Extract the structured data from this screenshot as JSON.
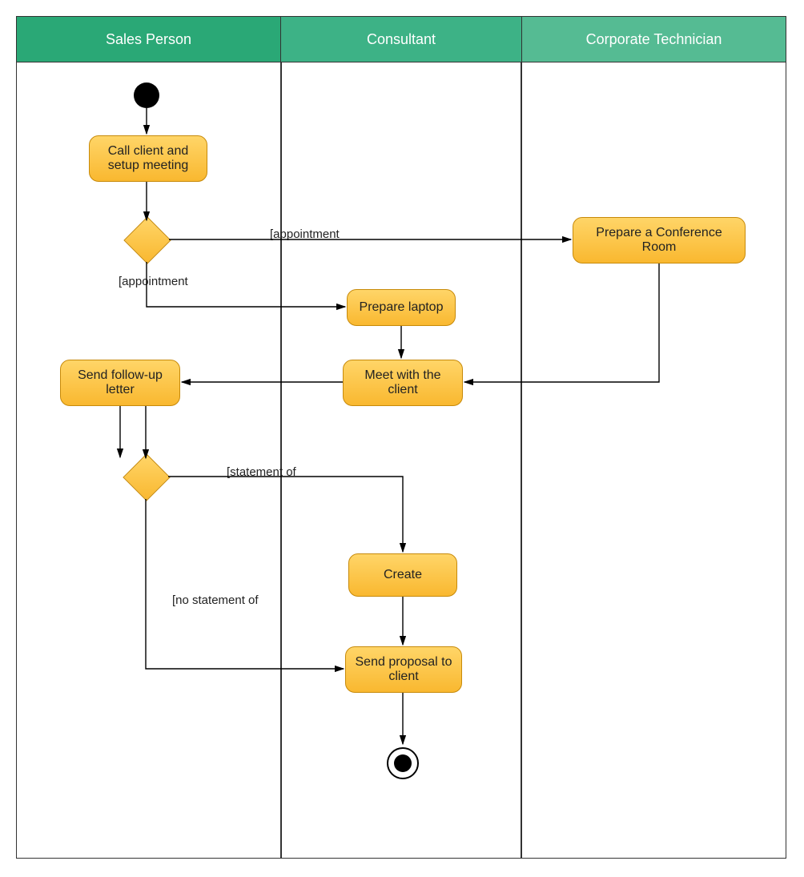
{
  "swimlanes": {
    "lane1": "Sales Person",
    "lane2": "Consultant",
    "lane3": "Corporate Technician"
  },
  "activities": {
    "call_client": "Call client and setup meeting",
    "prepare_conf": "Prepare a Conference Room",
    "prepare_laptop": "Prepare laptop",
    "meet_client": "Meet with the client",
    "send_followup": "Send follow-up letter",
    "create": "Create",
    "send_proposal": "Send proposal to client"
  },
  "edge_labels": {
    "appt1": "[appointment",
    "appt2": "[appointment",
    "stmt": "[statement of",
    "no_stmt": "[no statement of"
  }
}
